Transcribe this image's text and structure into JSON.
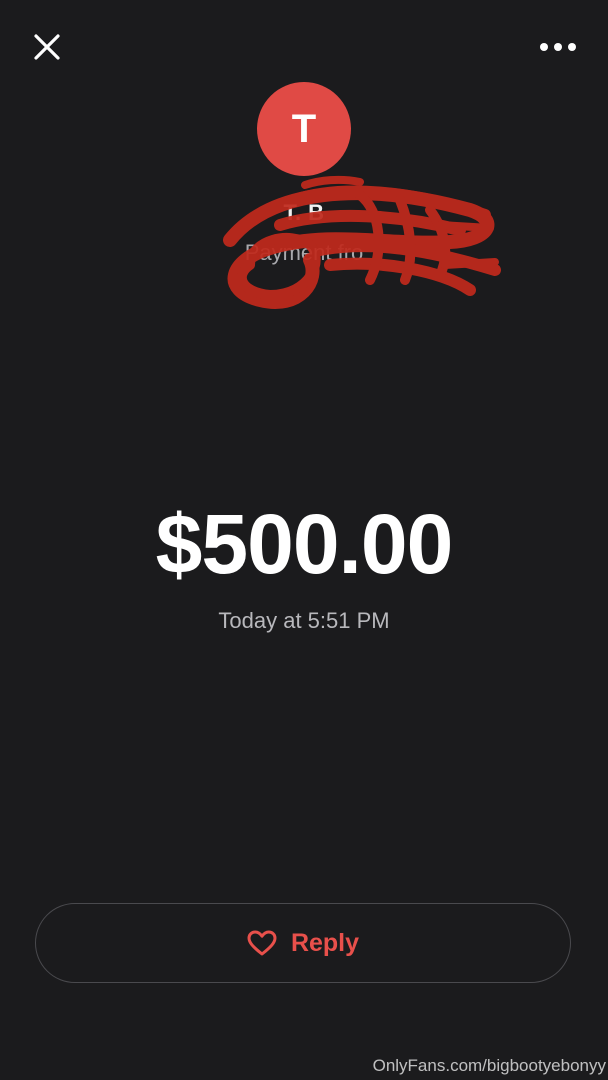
{
  "header": {
    "close_icon": "close-icon",
    "more_icon": "more-options-icon"
  },
  "sender": {
    "initial": "T",
    "name": "T. B",
    "subtitle": "Payment fro",
    "avatar_color": "#e04a45"
  },
  "payment": {
    "amount": "$500.00",
    "timestamp": "Today at 5:51 PM"
  },
  "actions": {
    "reply_label": "Reply",
    "reply_icon": "heart-icon",
    "accent_color": "#e8504b"
  },
  "watermark": {
    "text": "OnlyFans.com/bigbootyebonyy"
  },
  "colors": {
    "background": "#1b1b1d",
    "redaction": "#c0291c"
  }
}
